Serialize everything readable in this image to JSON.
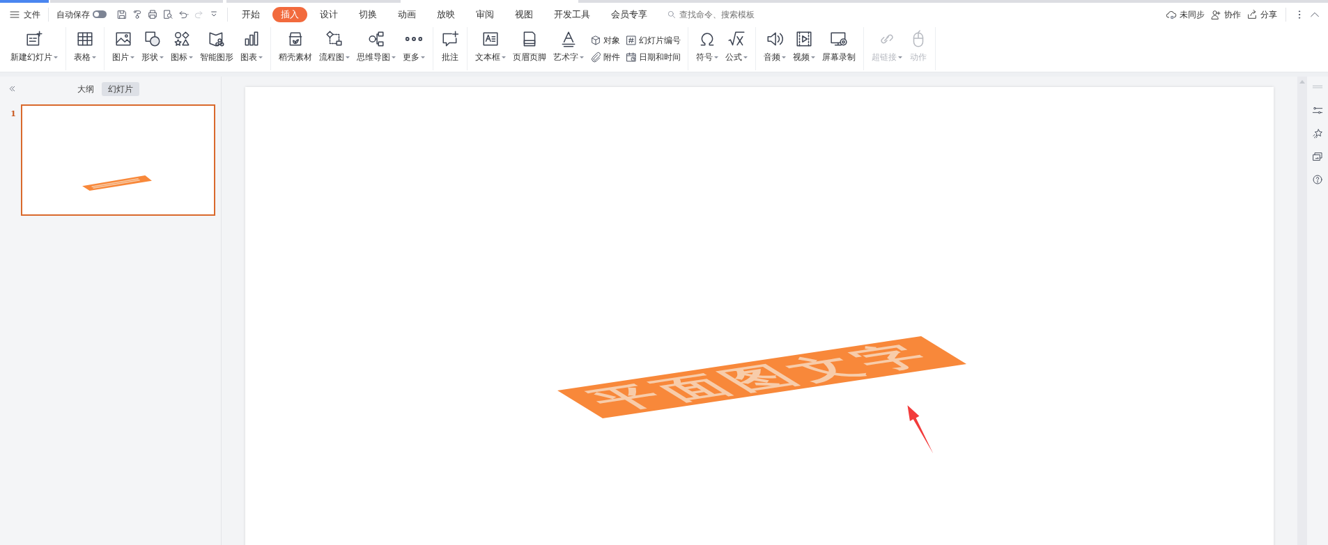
{
  "menu": {
    "file": "文件",
    "autosave": {
      "label": "自动保存",
      "on": false
    },
    "quick_tools": [
      {
        "disabled": false
      },
      {
        "disabled": false
      },
      {
        "disabled": false
      },
      {
        "disabled": false
      },
      {
        "disabled": false
      },
      {
        "disabled": true
      },
      {
        "disabled": false
      }
    ],
    "tabs": [
      {
        "label": "开始",
        "selected": false
      },
      {
        "label": "插入",
        "selected": true
      },
      {
        "label": "设计",
        "selected": false
      },
      {
        "label": "切换",
        "selected": false
      },
      {
        "label": "动画",
        "selected": false
      },
      {
        "label": "放映",
        "selected": false
      },
      {
        "label": "审阅",
        "selected": false
      },
      {
        "label": "视图",
        "selected": false
      },
      {
        "label": "开发工具",
        "selected": false
      },
      {
        "label": "会员专享",
        "selected": false
      }
    ],
    "search": {
      "placeholder": "查找命令、搜索模板"
    },
    "actions": [
      {
        "label": "未同步"
      },
      {
        "label": "协作"
      },
      {
        "label": "分享"
      }
    ]
  },
  "ribbon": {
    "groups": [
      {
        "items": [
          {
            "kind": "large",
            "label": "新建幻灯片",
            "dropdown": true,
            "disabled": false
          }
        ]
      },
      {
        "items": [
          {
            "kind": "large",
            "label": "表格",
            "dropdown": true,
            "disabled": false
          }
        ]
      },
      {
        "items": [
          {
            "kind": "large",
            "label": "图片",
            "dropdown": true,
            "disabled": false
          },
          {
            "kind": "large",
            "label": "形状",
            "dropdown": true,
            "disabled": false
          },
          {
            "kind": "large",
            "label": "图标",
            "dropdown": true,
            "disabled": false
          },
          {
            "kind": "large",
            "label": "智能图形",
            "dropdown": false,
            "disabled": false
          },
          {
            "kind": "large",
            "label": "图表",
            "dropdown": true,
            "disabled": false
          }
        ]
      },
      {
        "items": [
          {
            "kind": "large",
            "label": "稻壳素材",
            "dropdown": false,
            "disabled": false
          },
          {
            "kind": "large",
            "label": "流程图",
            "dropdown": true,
            "disabled": false
          },
          {
            "kind": "large",
            "label": "思维导图",
            "dropdown": true,
            "disabled": false
          },
          {
            "kind": "large",
            "label": "更多",
            "dropdown": true,
            "disabled": false
          }
        ]
      },
      {
        "items": [
          {
            "kind": "large",
            "label": "批注",
            "dropdown": false,
            "disabled": false
          }
        ]
      },
      {
        "items": [
          {
            "kind": "large",
            "label": "文本框",
            "dropdown": true,
            "disabled": false
          },
          {
            "kind": "large",
            "label": "页眉页脚",
            "dropdown": false,
            "disabled": false
          },
          {
            "kind": "large",
            "label": "艺术字",
            "dropdown": true,
            "disabled": false
          },
          {
            "kind": "pair",
            "entries": [
              {
                "label": "对象"
              },
              {
                "label": "附件"
              }
            ]
          },
          {
            "kind": "pair",
            "entries": [
              {
                "label": "幻灯片编号"
              },
              {
                "label": "日期和时间"
              }
            ]
          }
        ]
      },
      {
        "items": [
          {
            "kind": "large",
            "label": "符号",
            "dropdown": true,
            "disabled": false
          },
          {
            "kind": "large",
            "label": "公式",
            "dropdown": true,
            "disabled": false
          }
        ]
      },
      {
        "items": [
          {
            "kind": "large",
            "label": "音频",
            "dropdown": true,
            "disabled": false
          },
          {
            "kind": "large",
            "label": "视频",
            "dropdown": true,
            "disabled": false
          },
          {
            "kind": "large",
            "label": "屏幕录制",
            "dropdown": false,
            "disabled": false
          }
        ]
      },
      {
        "items": [
          {
            "kind": "large",
            "label": "超链接",
            "dropdown": true,
            "disabled": true
          },
          {
            "kind": "large",
            "label": "动作",
            "dropdown": false,
            "disabled": true
          }
        ]
      }
    ]
  },
  "panel": {
    "tabs": [
      {
        "label": "大纲",
        "selected": false
      },
      {
        "label": "幻灯片",
        "selected": true
      }
    ],
    "slides": [
      {
        "number": "1",
        "selected": true
      }
    ]
  },
  "slide": {
    "banner": {
      "text": "平面图文字"
    }
  }
}
